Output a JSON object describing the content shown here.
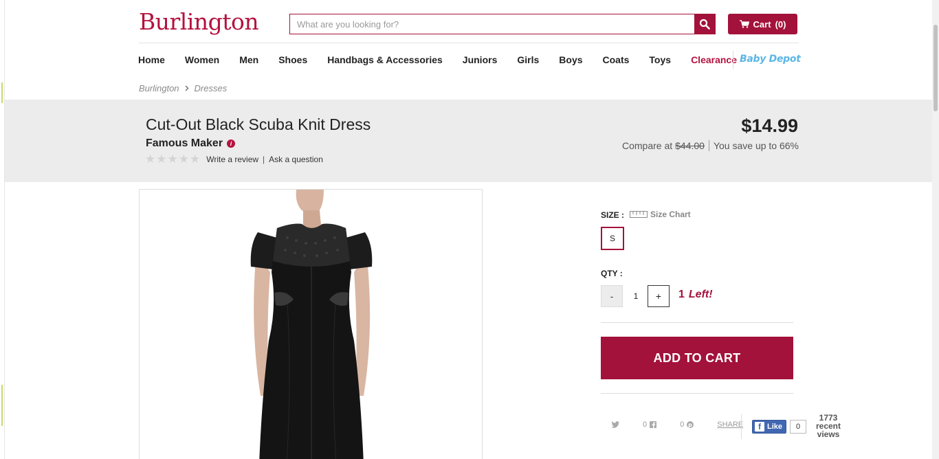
{
  "header": {
    "logo_text": "Burlington",
    "search_placeholder": "What are you looking for?",
    "cart_label": "Cart",
    "cart_count": "(0)"
  },
  "nav": {
    "items": [
      "Home",
      "Women",
      "Men",
      "Shoes",
      "Handbags & Accessories",
      "Juniors",
      "Girls",
      "Boys",
      "Coats",
      "Toys",
      "Clearance"
    ],
    "baby_depot": "Baby Depot"
  },
  "breadcrumb": [
    "Burlington",
    "Dresses"
  ],
  "product": {
    "title": "Cut-Out Black Scuba Knit Dress",
    "brand": "Famous Maker",
    "rating_stars": 0,
    "write_review": "Write a review",
    "ask_question": "Ask a question",
    "price": "$14.99",
    "compare_label": "Compare at",
    "compare_price": "$44.00",
    "savings": "You save up to 66%"
  },
  "options": {
    "size_label": "SIZE :",
    "size_chart": "Size Chart",
    "sizes": [
      "S"
    ],
    "qty_label": "QTY :",
    "qty_minus": "-",
    "qty_value": "1",
    "qty_plus": "+",
    "stock_count": "1",
    "stock_text": "Left!",
    "add_to_cart": "ADD TO CART"
  },
  "social": {
    "twitter_count": "",
    "facebook_count": "0",
    "pinterest_count": "0",
    "share_label": "SHARE",
    "like_label": "Like",
    "like_count": "0",
    "views_count": "1773",
    "views_line1": "recent",
    "views_line2": "views"
  },
  "colors": {
    "brand": "#a3123a",
    "band": "#ececec",
    "baby_depot": "#5bb6e5",
    "facebook": "#4267b2"
  }
}
